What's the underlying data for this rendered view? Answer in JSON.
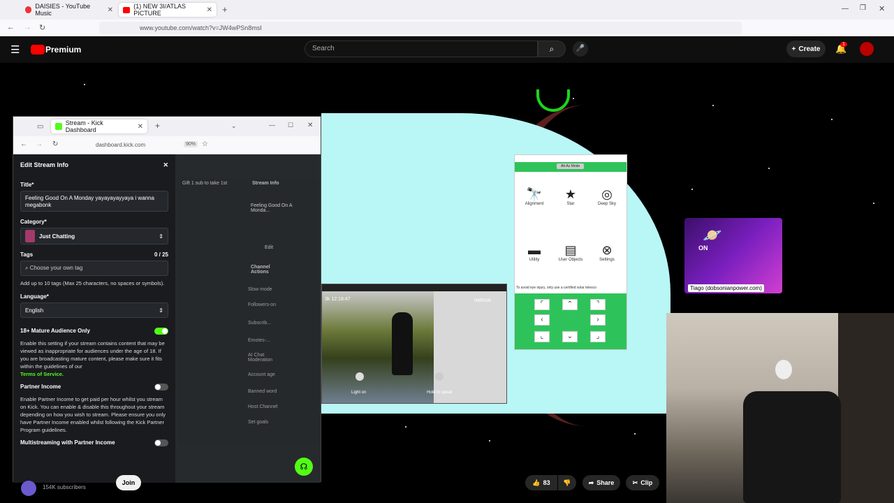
{
  "browser": {
    "tabs": [
      {
        "label": "DAISIES - YouTube Music"
      },
      {
        "label": "(1) NEW 3I/ATLAS PICTURE"
      }
    ],
    "url": "www.youtube.com/watch?v=JW4wPSn8msI"
  },
  "youtube": {
    "logo": "Premium",
    "search_placeholder": "Search",
    "create_label": "Create",
    "notif_count": "1",
    "subscribers": "154K subscribers",
    "join_label": "Join",
    "likes": "83",
    "share_label": "Share",
    "clip_label": "Clip"
  },
  "kick": {
    "tab_title": "Stream - Kick Dashboard",
    "url": "dashboard.kick.com",
    "zoom": "90%",
    "panel_title": "Edit Stream Info",
    "title_label": "Title*",
    "title_value": "Feeling Good On A Monday yayayayayyaya i wanna megabonk",
    "category_label": "Category*",
    "category_value": "Just Chatting",
    "tags_label": "Tags",
    "tags_count": "0 / 25",
    "tags_placeholder": "Choose your own tag",
    "tags_help": "Add up to 10 tags (Max 25 characters, no spaces or symbols).",
    "language_label": "Language*",
    "language_value": "English",
    "mature_label": "18+ Mature Audience Only",
    "mature_help": "Enable this setting if your stream contains content that may be viewed as inappropriate for audiences under the age of 18. If you are broadcasting mature content, please make sure it fits within the guidelines of our",
    "terms_link": "Terms of Service.",
    "partner_label": "Partner Income",
    "partner_help": "Enable Partner Income to get paid per hour whilst you stream on Kick. You can enable & disable this throughout your stream depending on how you wish to stream. Please ensure you only have Partner Income enabled whilst following the Kick Partner Program guidelines.",
    "multistream_label": "Multistreaming with Partner Income",
    "stream_info_label": "Stream Info",
    "stream_title_preview": "Feeling Good On A Monda...",
    "edit_label": "Edit",
    "channel_actions": "Channel Actions",
    "side_items": [
      "Slow mode",
      "Followers-on",
      "Subscrib...",
      "Emotes-...",
      "AI Chat Moderation",
      "Account age",
      "Banned word",
      "Host Channel",
      "Set goals"
    ],
    "chat_snippet": "Gift 1 sub to take 1st"
  },
  "telescope": {
    "mode": "Alt-Az Mode",
    "items": [
      "Alignment",
      "Star",
      "Deep Sky",
      "Utility",
      "User Objects",
      "Settings"
    ],
    "warning": "To avoid eye injury, only use a certified solar telesco"
  },
  "camera": {
    "timestamp": "3k 12:18:47",
    "brand": "netvue",
    "light_label": "Light on",
    "speak_label": "Hold to speak"
  },
  "overlay": {
    "on_label": "ON",
    "name_tag": "Tiago (dobsonianpower.com)"
  }
}
